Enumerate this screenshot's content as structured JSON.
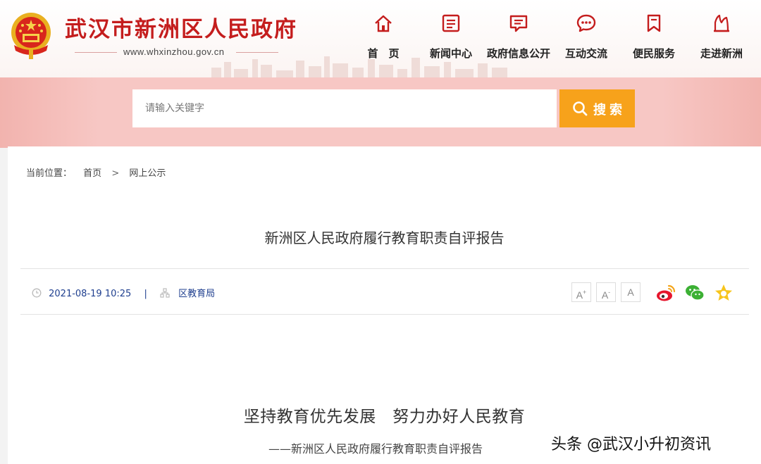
{
  "header": {
    "site_title": "武汉市新洲区人民政府",
    "site_url": "www.whxinzhou.gov.cn",
    "brand_color": "#c41d1d"
  },
  "nav": [
    {
      "label": "首　页",
      "icon": "home-icon"
    },
    {
      "label": "新闻中心",
      "icon": "news-icon"
    },
    {
      "label": "政府信息公开",
      "icon": "info-icon"
    },
    {
      "label": "互动交流",
      "icon": "chat-icon"
    },
    {
      "label": "便民服务",
      "icon": "bookmark-icon"
    },
    {
      "label": "走进新洲",
      "icon": "landmark-icon"
    }
  ],
  "search": {
    "placeholder": "请输入关键字",
    "button_label": "搜索",
    "button_color": "#f7a21b"
  },
  "breadcrumb": {
    "prefix": "当前位置：",
    "items": [
      "首页",
      "网上公示"
    ],
    "separator": ">"
  },
  "article": {
    "title": "新洲区人民政府履行教育职责自评报告",
    "date": "2021-08-19 10:25",
    "source": "区教育局",
    "font_sizes": [
      "A+",
      "A-",
      "A"
    ],
    "share": [
      "weibo-icon",
      "wechat-icon",
      "favorite-icon"
    ],
    "heading": "坚持教育优先发展　努力办好人民教育",
    "subheading": "——新洲区人民政府履行教育职责自评报告"
  },
  "watermark": "头条 @武汉小升初资讯"
}
